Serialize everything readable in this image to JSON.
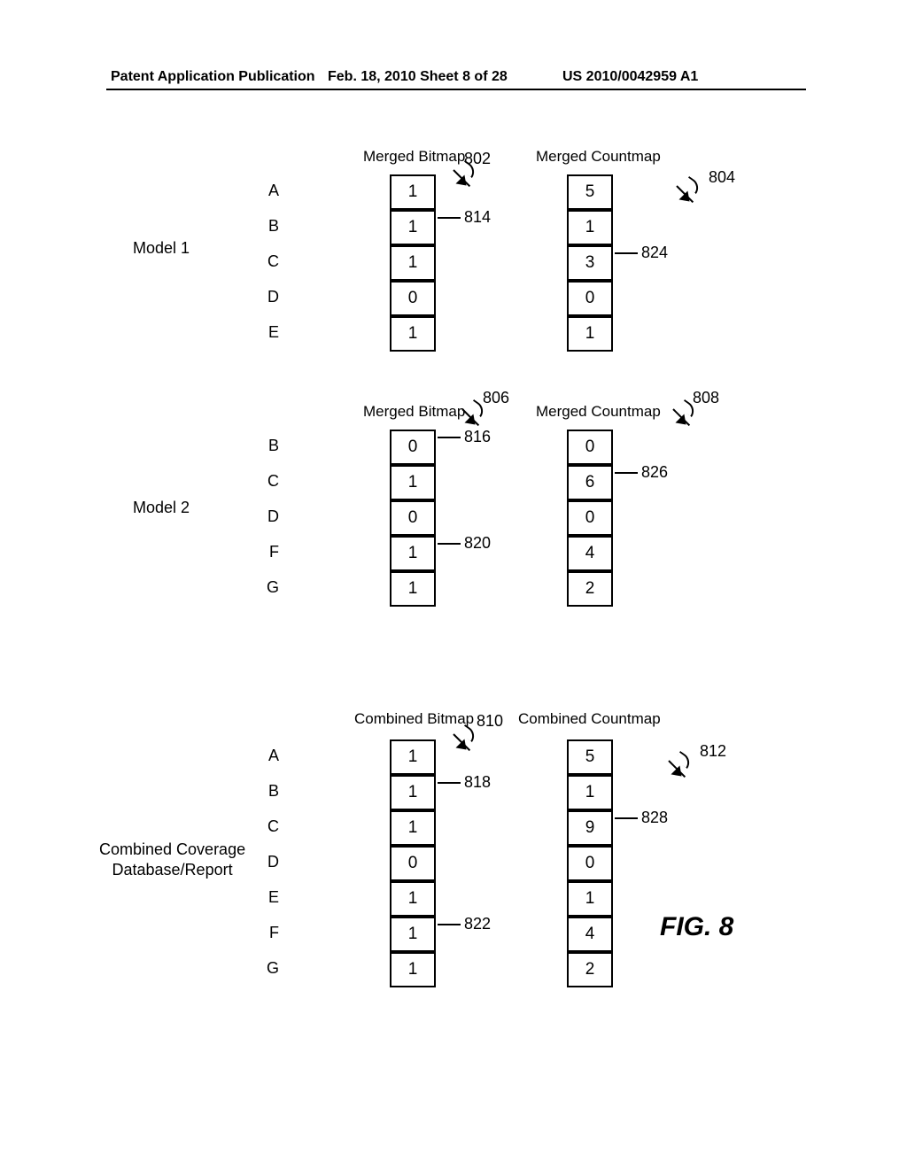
{
  "header": {
    "left": "Patent Application Publication",
    "center": "Feb. 18, 2010  Sheet 8 of 28",
    "right": "US 2010/0042959 A1"
  },
  "figure_label": "FIG. 8",
  "common": {
    "merged_bitmap": "Merged Bitmap",
    "merged_countmap": "Merged Countmap",
    "combined_bitmap": "Combined Bitmap",
    "combined_countmap": "Combined Countmap"
  },
  "model1": {
    "label": "Model 1",
    "rows": [
      "A",
      "B",
      "C",
      "D",
      "E"
    ],
    "bitmap": [
      "1",
      "1",
      "1",
      "0",
      "1"
    ],
    "countmap": [
      "5",
      "1",
      "3",
      "0",
      "1"
    ],
    "ref_bitmap_header": "802",
    "ref_countmap_header": "804",
    "ref_bitmap_cell": "814",
    "ref_countmap_cell": "824"
  },
  "model2": {
    "label": "Model 2",
    "rows": [
      "B",
      "C",
      "D",
      "F",
      "G"
    ],
    "bitmap": [
      "0",
      "1",
      "0",
      "1",
      "1"
    ],
    "countmap": [
      "0",
      "6",
      "0",
      "4",
      "2"
    ],
    "ref_bitmap_header": "806",
    "ref_countmap_header": "808",
    "ref_bitmap_cell_top": "816",
    "ref_bitmap_cell_f": "820",
    "ref_countmap_cell": "826"
  },
  "combined": {
    "label": "Combined Coverage\nDatabase/Report",
    "rows": [
      "A",
      "B",
      "C",
      "D",
      "E",
      "F",
      "G"
    ],
    "bitmap": [
      "1",
      "1",
      "1",
      "0",
      "1",
      "1",
      "1"
    ],
    "countmap": [
      "5",
      "1",
      "9",
      "0",
      "1",
      "4",
      "2"
    ],
    "ref_bitmap_header": "810",
    "ref_countmap_header": "812",
    "ref_bitmap_cell_b": "818",
    "ref_bitmap_cell_f": "822",
    "ref_countmap_cell": "828"
  }
}
